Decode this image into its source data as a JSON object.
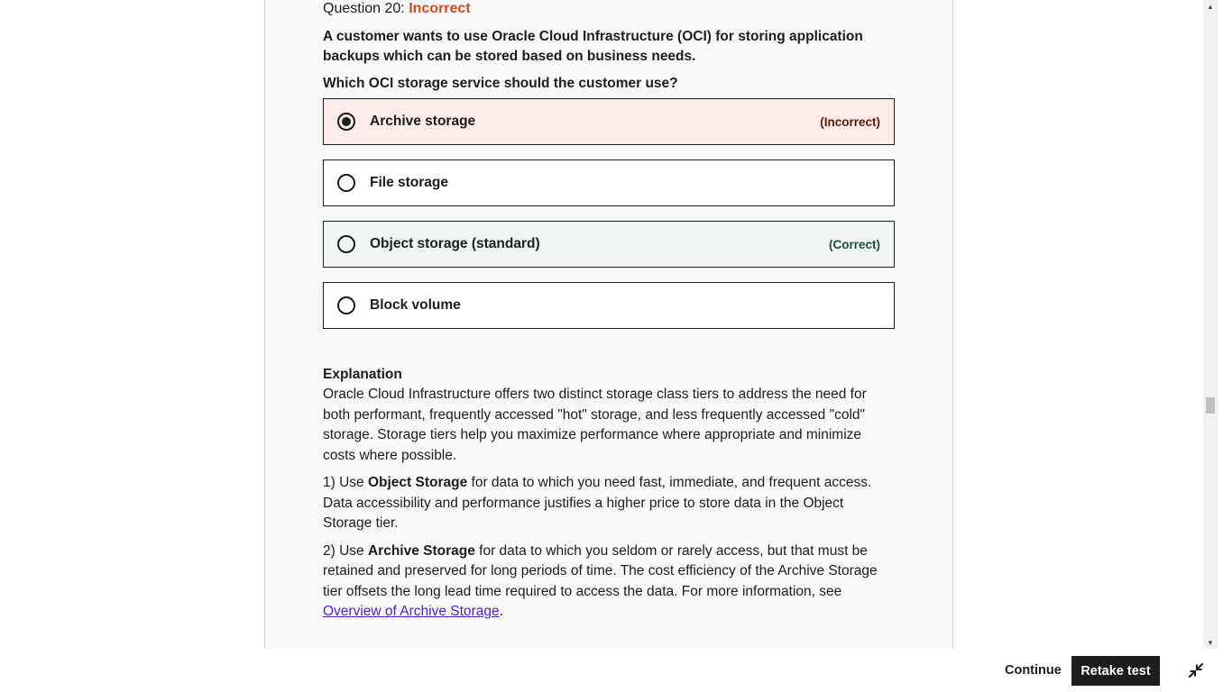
{
  "question": {
    "header_prefix": "Question 20:",
    "status": "Incorrect",
    "text": "A customer wants to use Oracle Cloud Infrastructure (OCI) for storing application backups which can be stored based on business needs.",
    "prompt": "Which OCI storage service should the customer use?"
  },
  "options": [
    {
      "label": "Archive storage",
      "tag": "(Incorrect)",
      "selected": true
    },
    {
      "label": "File storage",
      "tag": "",
      "selected": false
    },
    {
      "label": "Object storage (standard)",
      "tag": "(Correct)",
      "selected": false
    },
    {
      "label": "Block volume",
      "tag": "",
      "selected": false
    }
  ],
  "explanation": {
    "title": "Explanation",
    "intro": "Oracle Cloud Infrastructure offers two distinct storage class tiers to address the need for both performant, frequently accessed \"hot\" storage, and less frequently accessed \"cold\" storage. Storage tiers help you maximize performance where appropriate and minimize costs where possible.",
    "point1_prefix": "1) Use ",
    "point1_bold": "Object Storage",
    "point1_rest": " for data to which you need fast, immediate, and frequent access. Data accessibility and performance justifies a higher price to store data in the Object Storage tier.",
    "point2_prefix": "2) Use ",
    "point2_bold": "Archive Storage",
    "point2_rest": " for data to which you seldom or rarely access, but that must be retained and preserved for long periods of time. The cost efficiency of the Archive Storage tier offsets the long lead time required to access the data. For more information, see ",
    "point2_link": "Overview of Archive Storage",
    "point2_end": "."
  },
  "footer": {
    "continue_label": "Continue",
    "retake_label": "Retake test",
    "expand_icon": "collapse-icon"
  },
  "colors": {
    "incorrect_status": "#d1491b",
    "incorrect_bg": "#fcebe8",
    "correct_bg": "#f1f5f3",
    "link": "#5022c3",
    "primary_button": "#1c1d1f"
  }
}
